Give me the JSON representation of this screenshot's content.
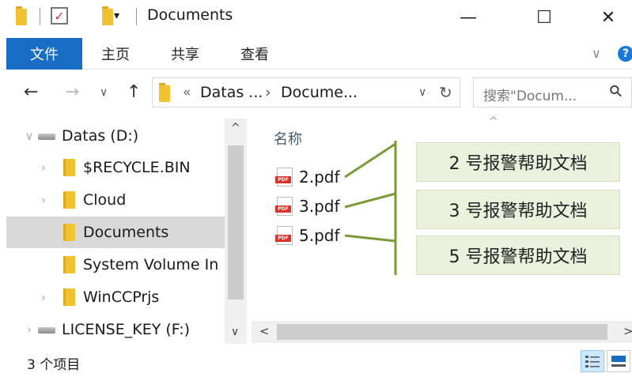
{
  "window": {
    "title": "Documents",
    "minimize_glyph": "—",
    "maximize_glyph": "☐",
    "close_glyph": "✕"
  },
  "ribbon": {
    "tabs": [
      {
        "label": "文件",
        "active": true
      },
      {
        "label": "主页"
      },
      {
        "label": "共享"
      },
      {
        "label": "查看"
      }
    ],
    "expand_glyph": "∨",
    "help_glyph": "?"
  },
  "nav": {
    "back_glyph": "←",
    "forward_glyph": "→",
    "recent_glyph": "∨",
    "up_glyph": "↑",
    "address": {
      "overflow": "«",
      "crumbs": [
        "Datas ...",
        "Docume..."
      ],
      "separator": "›",
      "dropdown_glyph": "∨",
      "refresh_glyph": "↻"
    },
    "search": {
      "placeholder": "搜索\"Docum...",
      "icon_glyph": "⚲"
    }
  },
  "tree": {
    "items": [
      {
        "label": "Datas (D:)",
        "type": "drive",
        "expanded": true
      },
      {
        "label": "$RECYCLE.BIN",
        "type": "folder"
      },
      {
        "label": "Cloud",
        "type": "folder"
      },
      {
        "label": "Documents",
        "type": "folder",
        "selected": true
      },
      {
        "label": "System Volume In",
        "type": "folder"
      },
      {
        "label": "WinCCPrjs",
        "type": "folder"
      },
      {
        "label": "LICENSE_KEY (F:)",
        "type": "drive"
      }
    ],
    "scroll_up_glyph": "^",
    "scroll_down_glyph": "∨"
  },
  "files": {
    "column_name": "名称",
    "sort_glyph": "^",
    "items": [
      {
        "name": "2.pdf"
      },
      {
        "name": "3.pdf"
      },
      {
        "name": "5.pdf"
      }
    ],
    "icon_text": "PDF",
    "scroll_left_glyph": "<",
    "scroll_right_glyph": ">"
  },
  "status": {
    "count_text": "3 个项目"
  },
  "callouts": [
    {
      "text": "2 号报警帮助文档"
    },
    {
      "text": "3 号报警帮助文档"
    },
    {
      "text": "5 号报警帮助文档"
    }
  ],
  "colors": {
    "accent": "#1a6dc4",
    "selection": "#d9d9d9",
    "folder": "#f1c232",
    "callout_bg": "#ebf1dd",
    "callout_line": "#7a9a3a"
  }
}
